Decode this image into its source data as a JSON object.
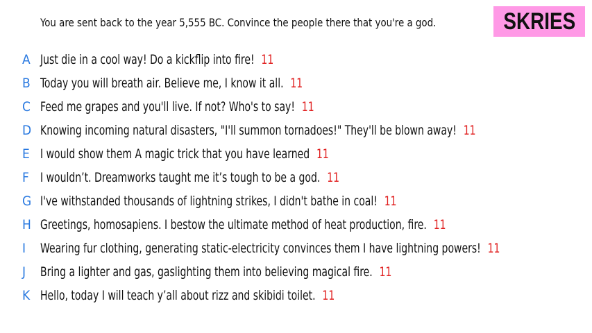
{
  "prompt": "You are sent back to the year 5,555 BC. Convince the people there that you're a god.",
  "logo": {
    "text": "SKRIES",
    "background": "#ff99e6"
  },
  "colors": {
    "letter": "#2979e0",
    "votes": "#e01f1f",
    "text": "#111111"
  },
  "answers": [
    {
      "letter": "A",
      "text": "Just die in a cool way! Do a kickflip into fire!",
      "votes": "11"
    },
    {
      "letter": "B",
      "text": "Today you will breath air. Believe me, I know it all.",
      "votes": "11"
    },
    {
      "letter": "C",
      "text": "Feed me grapes and you'll live. If not? Who's to say!",
      "votes": "11"
    },
    {
      "letter": "D",
      "text": "Knowing incoming natural disasters, \"I'll summon tornadoes!\" They'll be blown away!",
      "votes": "11"
    },
    {
      "letter": "E",
      "text": "I would show them A magic trick that you have learned",
      "votes": "11"
    },
    {
      "letter": "F",
      "text": "I wouldn’t. Dreamworks taught me it’s tough to be a god.",
      "votes": "11"
    },
    {
      "letter": "G",
      "text": "I've withstanded thousands of lightning strikes, I didn't bathe in coal!",
      "votes": "11"
    },
    {
      "letter": "H",
      "text": "Greetings, homosapiens. I bestow the ultimate method of heat production, fire.",
      "votes": "11"
    },
    {
      "letter": "I",
      "text": "Wearing fur clothing, generating static-electricity convinces them I have lightning powers!",
      "votes": "11"
    },
    {
      "letter": "J",
      "text": "Bring a lighter and gas, gaslighting them into believing magical fire.",
      "votes": "11"
    },
    {
      "letter": "K",
      "text": "Hello, today I will teach y’all about rizz and skibidi toilet.",
      "votes": "11"
    }
  ]
}
